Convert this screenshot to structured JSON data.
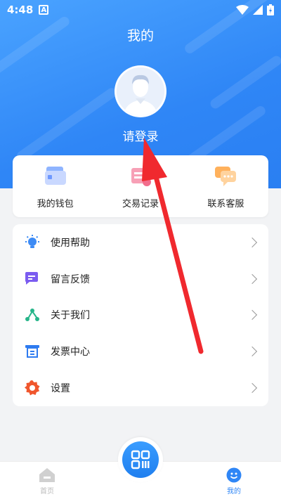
{
  "status_bar": {
    "time": "4:48",
    "app_badge": "A"
  },
  "header": {
    "title": "我的",
    "login_prompt": "请登录"
  },
  "quick_actions": [
    {
      "label": "我的钱包",
      "icon": "wallet-icon"
    },
    {
      "label": "交易记录",
      "icon": "transaction-record-icon"
    },
    {
      "label": "联系客服",
      "icon": "customer-service-icon"
    }
  ],
  "menu": [
    {
      "label": "使用帮助",
      "icon": "lightbulb-icon"
    },
    {
      "label": "留言反馈",
      "icon": "feedback-chat-icon"
    },
    {
      "label": "关于我们",
      "icon": "share-nodes-icon"
    },
    {
      "label": "发票中心",
      "icon": "invoice-icon"
    },
    {
      "label": "设置",
      "icon": "gear-icon"
    }
  ],
  "tab_bar": {
    "home_label": "首页",
    "mine_label": "我的",
    "active_color": "#2f86f6",
    "inactive_color": "#c8c8c8"
  },
  "colors": {
    "brand": "#2f86f6",
    "annotation_arrow": "#f0292e"
  }
}
